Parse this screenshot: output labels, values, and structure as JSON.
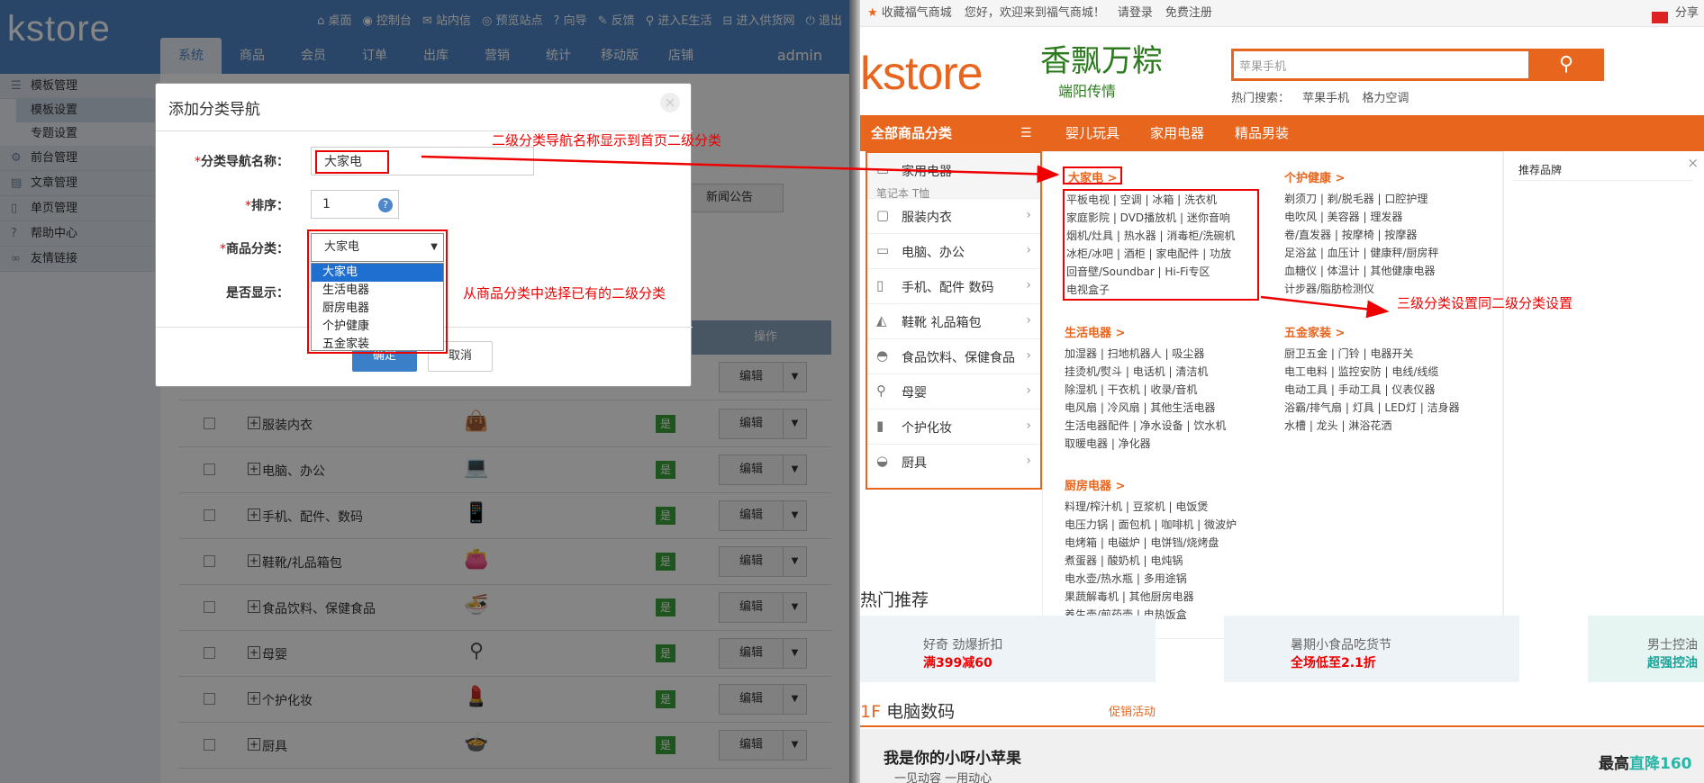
{
  "admin": {
    "logo": "kstore",
    "top_links": [
      "桌面",
      "控制台",
      "站内信",
      "预览站点",
      "向导",
      "反馈",
      "进入E生活",
      "进入供货网",
      "退出"
    ],
    "nav": [
      "系统",
      "商品",
      "会员",
      "订单",
      "出库",
      "营销",
      "统计",
      "移动版",
      "店铺"
    ],
    "user": "admin",
    "sidebar": {
      "groups": [
        {
          "label": "模板管理",
          "items": [
            "模板设置",
            "专题设置"
          ]
        },
        {
          "label": "前台管理"
        },
        {
          "label": "文章管理"
        },
        {
          "label": "单页管理"
        },
        {
          "label": "帮助中心"
        },
        {
          "label": "友情链接"
        }
      ]
    },
    "ghost_tab": "新闻公告",
    "table": {
      "op_header": "操作",
      "rows": [
        "服装内衣",
        "电脑、办公",
        "手机、配件、数码",
        "鞋靴/礼品箱包",
        "食品饮料、保健食品",
        "母婴",
        "个护化妆",
        "厨具"
      ],
      "yes": "是",
      "edit": "编辑"
    }
  },
  "modal": {
    "title": "添加分类导航",
    "fields": {
      "name_label": "分类导航名称：",
      "name_value": "大家电",
      "sort_label": "排序：",
      "sort_value": "1",
      "cat_label": "商品分类：",
      "cat_value": "大家电",
      "show_label": "是否显示："
    },
    "dropdown": [
      "大家电",
      "生活电器",
      "厨房电器",
      "个护健康",
      "五金家装"
    ],
    "ok": "确定",
    "cancel": "取消",
    "required_mark": "*"
  },
  "annotations": {
    "a1": "二级分类导航名称显示到首页二级分类",
    "a2": "从商品分类中选择已有的二级分类",
    "a3": "三级分类设置同二级分类设置"
  },
  "store": {
    "topbar": {
      "fav": "收藏福气商城",
      "welcome": "您好，欢迎来到福气商城！",
      "login": "请登录",
      "register": "免费注册",
      "share": "分享"
    },
    "logo": "kstore",
    "promo": "香飘万粽",
    "promo_sub": "端阳传情",
    "search_placeholder": "苹果手机",
    "hot_label": "热门搜索：",
    "hot_words": [
      "苹果手机",
      "格力空调"
    ],
    "nav_all": "全部商品分类",
    "nav_items": [
      "婴儿玩具",
      "家用电器",
      "精品男装"
    ],
    "cat_first": {
      "title": "家用电器",
      "sub": "笔记本 T恤"
    },
    "cats": [
      "服装内衣",
      "电脑、办公",
      "手机、配件 数码",
      "鞋靴 礼品箱包",
      "食品饮料、保健食品",
      "母婴",
      "个护化妆",
      "厨具"
    ],
    "mega": {
      "g1": {
        "title": "大家电 >",
        "lines": [
          "平板电视 | 空调 | 冰箱 | 洗衣机",
          "家庭影院 | DVD播放机 | 迷你音响",
          "烟机/灶具 | 热水器 | 消毒柜/洗碗机",
          "冰柜/冰吧 | 酒柜 | 家电配件 | 功放",
          "回音壁/Soundbar | Hi-Fi专区",
          "电视盒子"
        ]
      },
      "g2": {
        "title": "个护健康 >",
        "lines": [
          "剃须刀 | 剃/脱毛器 | 口腔护理",
          "电吹风 | 美容器 | 理发器",
          "卷/直发器 | 按摩椅 | 按摩器",
          "足浴盆 | 血压计 | 健康秤/厨房秤",
          "血糖仪 | 体温计 | 其他健康电器",
          "计步器/脂肪检测仪"
        ]
      },
      "g3": {
        "title": "生活电器 >",
        "lines": [
          "加湿器 | 扫地机器人 | 吸尘器",
          "挂烫机/熨斗 | 电话机 | 清洁机",
          "除湿机 | 干衣机 | 收录/音机",
          "电风扇 | 冷风扇 | 其他生活电器",
          "生活电器配件 | 净水设备 | 饮水机",
          "取暖电器 | 净化器"
        ]
      },
      "g4": {
        "title": "五金家装 >",
        "lines": [
          "厨卫五金 | 门铃 | 电器开关",
          "电工电料 | 监控安防 | 电线/线缆",
          "电动工具 | 手动工具 | 仪表仪器",
          "浴霸/排气扇 | 灯具 | LED灯 | 洁身器",
          "水槽 | 龙头 | 淋浴花洒"
        ]
      },
      "g5": {
        "title": "厨房电器 >",
        "lines": [
          "料理/榨汁机 | 豆浆机 | 电饭煲",
          "电压力锅 | 面包机 | 咖啡机 | 微波炉",
          "电烤箱 | 电磁炉 | 电饼铛/烧烤盘",
          "煮蛋器 | 酸奶机 | 电炖锅",
          "电水壶/热水瓶 | 多用途锅",
          "果蔬解毒机 | 其他厨房电器",
          "养生壶/煎药壶 | 电热饭盒"
        ]
      }
    },
    "brand_title": "推荐品牌",
    "hot_title": "热门推荐",
    "banners": [
      {
        "a": "好奇 劲爆折扣",
        "b": "满399减60"
      },
      {
        "a": "暑期小食品吃货节",
        "b": "全场低至2.1折"
      },
      {
        "a": "男士控油",
        "b": "超强控油"
      }
    ],
    "floor": {
      "num": "1F",
      "name": "电脑数码",
      "promo": "促销活动"
    },
    "floor_banner": {
      "left": "我是你的小呀小苹果",
      "left2": "一见动容 一用动心",
      "right": "最高",
      "right2": "直降160"
    }
  }
}
